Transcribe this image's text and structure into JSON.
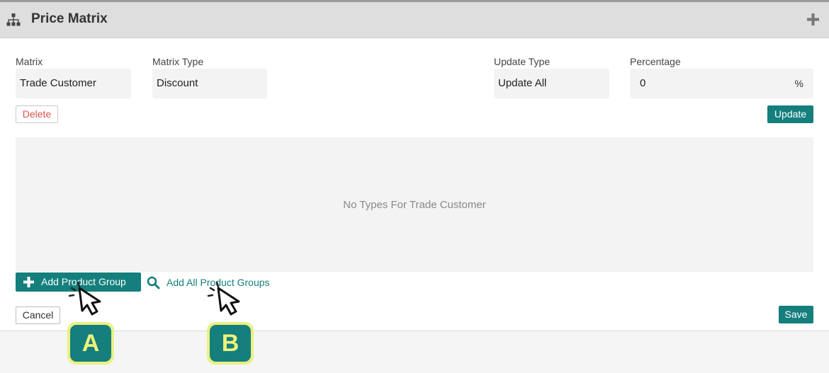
{
  "header": {
    "title": "Price Matrix"
  },
  "fields": {
    "matrix": {
      "label": "Matrix",
      "value": "Trade Customer"
    },
    "matrix_type": {
      "label": "Matrix Type",
      "value": "Discount"
    },
    "update_type": {
      "label": "Update Type",
      "value": "Update All"
    },
    "percentage": {
      "label": "Percentage",
      "value": "0",
      "suffix": "%"
    }
  },
  "buttons": {
    "delete": "Delete",
    "update": "Update",
    "add_product_group": "Add Product Group",
    "add_all_product_groups": "Add All Product Groups",
    "cancel": "Cancel",
    "save": "Save"
  },
  "types_area": {
    "empty_text": "No Types For Trade Customer"
  },
  "markers": {
    "a": "A",
    "b": "B"
  },
  "colors": {
    "accent": "#147f7c",
    "danger": "#d9534f",
    "marker_fill": "#eaf082"
  }
}
